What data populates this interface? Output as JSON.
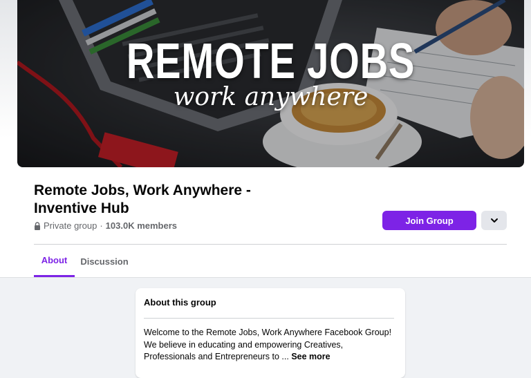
{
  "cover": {
    "title": "REMOTE JOBS",
    "subtitle": "work anywhere"
  },
  "group": {
    "name": "Remote Jobs, Work Anywhere - Inventive Hub",
    "privacy": "Private group",
    "separator": "·",
    "members": "103.0K members"
  },
  "actions": {
    "join_label": "Join Group",
    "more_icon": "chevron-down-icon"
  },
  "tabs": [
    {
      "label": "About",
      "active": true
    },
    {
      "label": "Discussion",
      "active": false
    }
  ],
  "about": {
    "title": "About this group",
    "description": "Welcome to the Remote Jobs, Work Anywhere Facebook Group! We believe in educating and empowering Creatives, Professionals and Entrepreneurs to ...",
    "see_more": "See more"
  },
  "colors": {
    "accent": "#7d23e6",
    "page_bg": "#f0f2f5",
    "muted_text": "#65676b"
  }
}
